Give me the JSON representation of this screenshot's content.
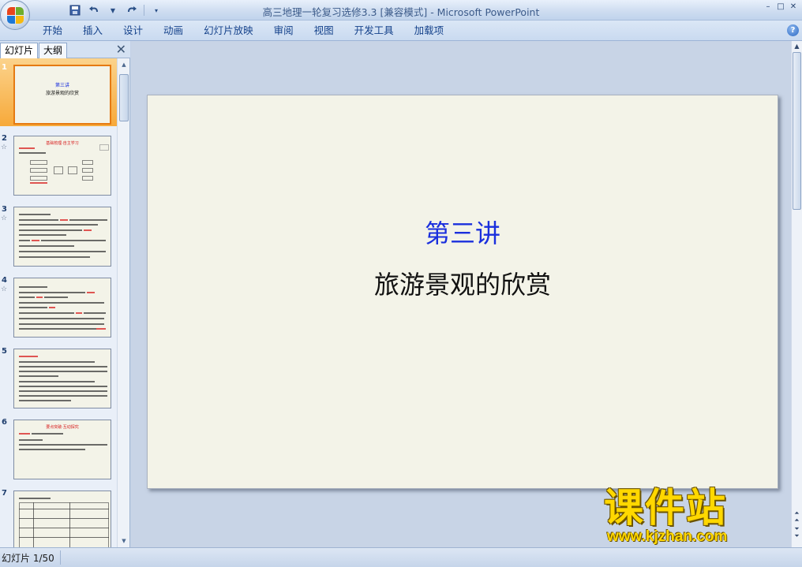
{
  "window": {
    "title": "高三地理一轮复习选修3.3 [兼容模式] - Microsoft PowerPoint",
    "controls": {
      "minimize": "–",
      "restore": "□",
      "close": "✕"
    }
  },
  "qat": {
    "save_icon": "save-icon",
    "undo_icon": "undo-icon",
    "redo_icon": "redo-icon",
    "customize_icon": "dropdown-icon"
  },
  "ribbon": {
    "tabs": [
      "开始",
      "插入",
      "设计",
      "动画",
      "幻灯片放映",
      "审阅",
      "视图",
      "开发工具",
      "加载项"
    ],
    "help_label": "?"
  },
  "left_panel": {
    "tabs": [
      "幻灯片",
      "大纲"
    ],
    "close_label": "✕",
    "thumbnails": [
      {
        "number": "1",
        "title": "第三讲",
        "subtitle": "旅游景观的欣赏"
      },
      {
        "number": "2",
        "star": "☆",
        "title": "基础梳理·自主学习"
      },
      {
        "number": "3",
        "star": "☆"
      },
      {
        "number": "4",
        "star": "☆"
      },
      {
        "number": "5"
      },
      {
        "number": "6",
        "title": "要点突破·互动探究"
      },
      {
        "number": "7"
      }
    ]
  },
  "slide": {
    "title": "第三讲",
    "subtitle": "旅游景观的欣赏"
  },
  "watermark": {
    "text": "课件站",
    "url": "www.kjzhan.com"
  },
  "status": {
    "slide_indicator": "幻灯片 1/50"
  }
}
